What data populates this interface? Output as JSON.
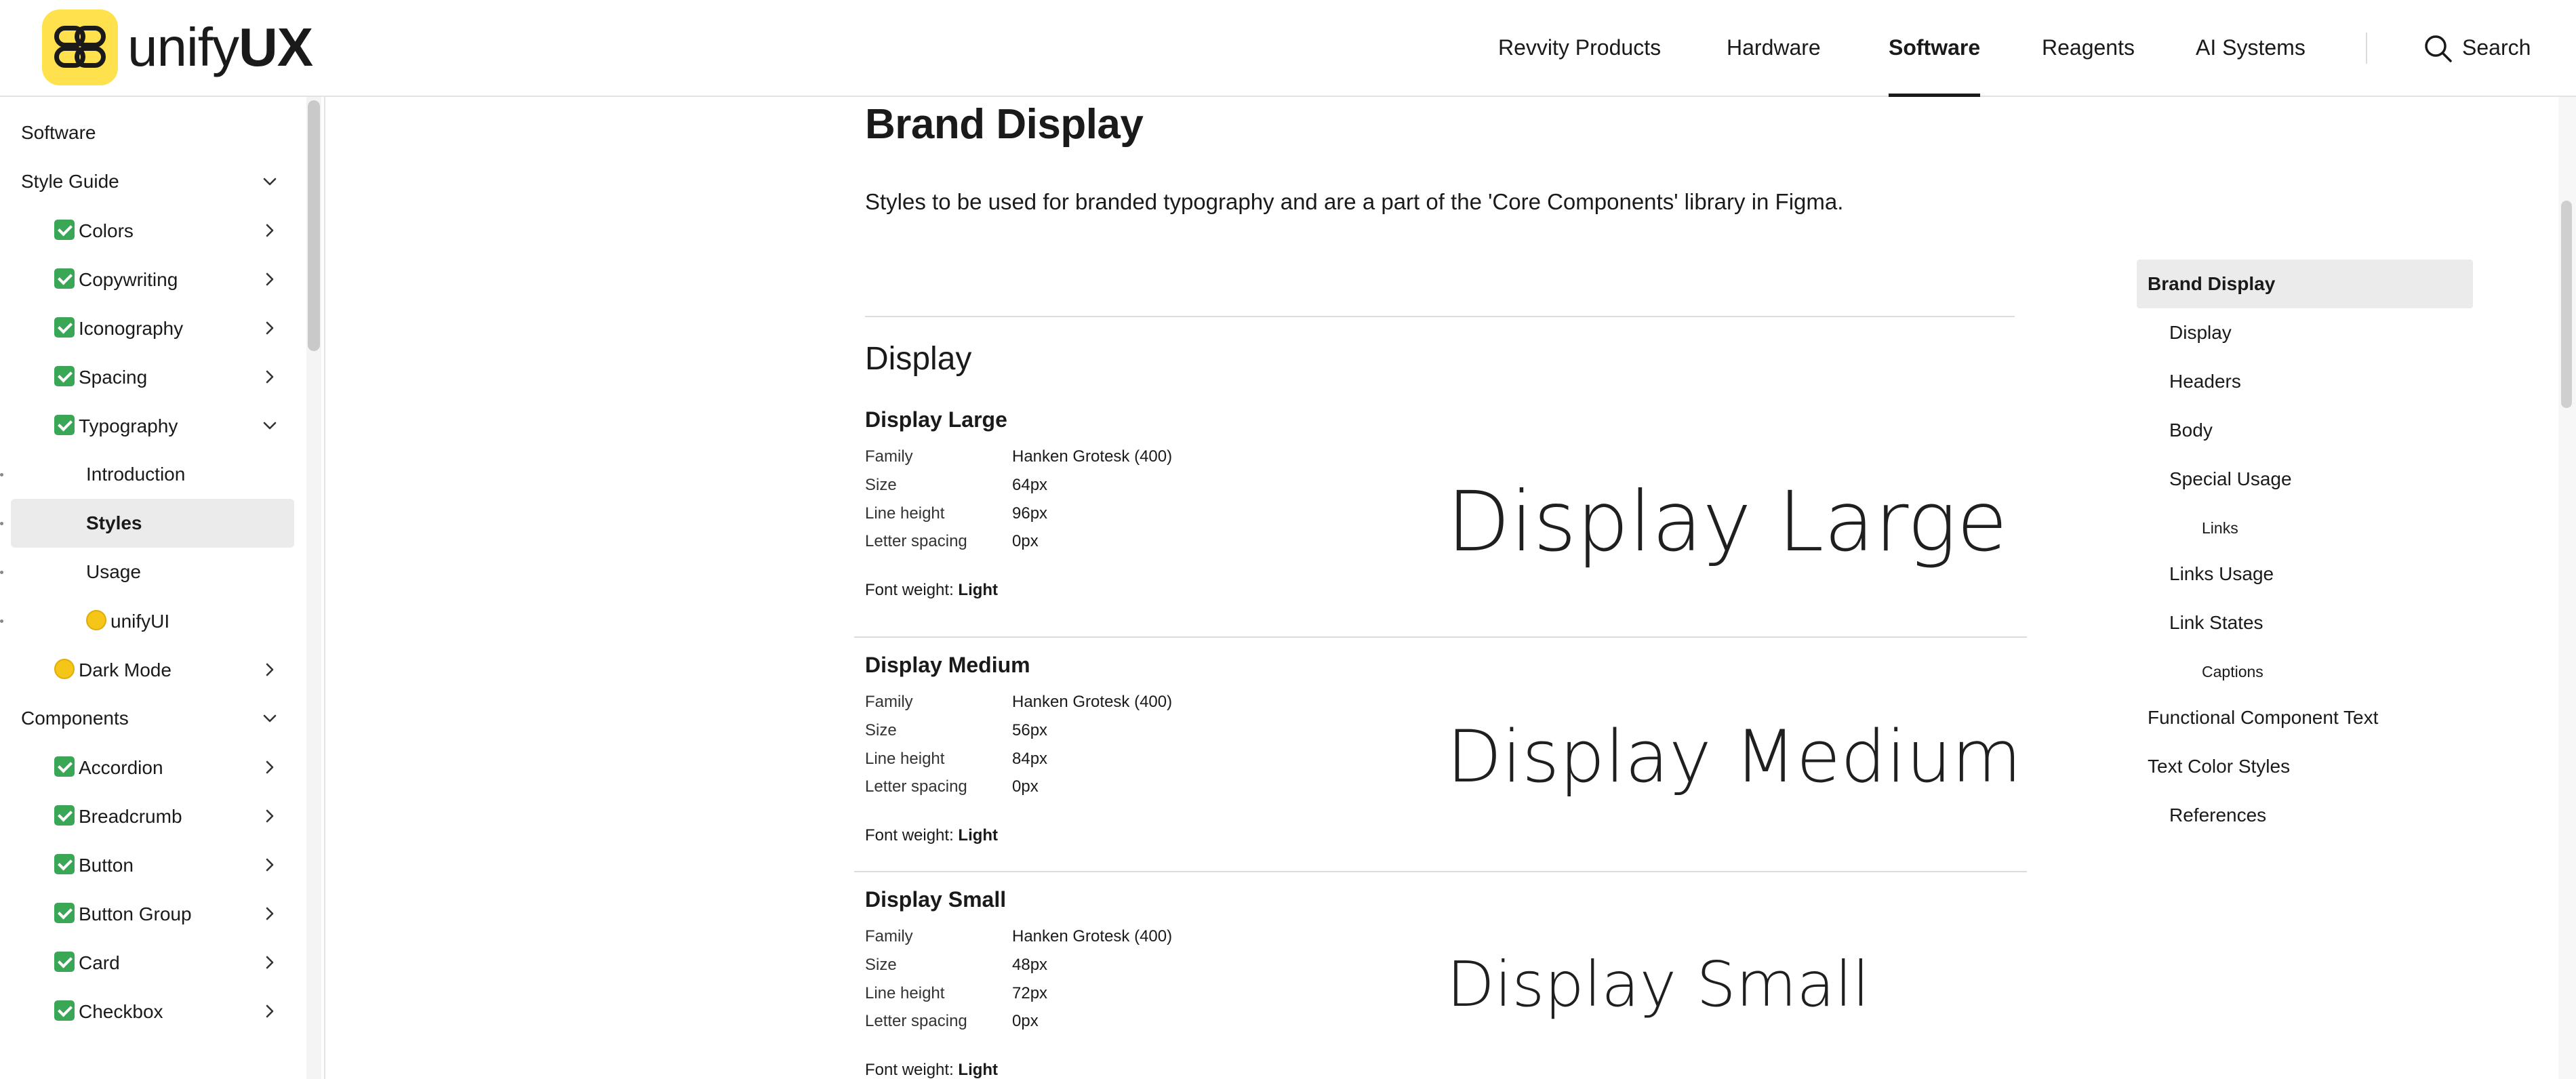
{
  "header": {
    "logo_text_light": "unify",
    "logo_text_bold": "UX",
    "nav": [
      "Revvity Products",
      "Hardware",
      "Software",
      "Reagents",
      "AI Systems"
    ],
    "active_nav": "Software",
    "search_label": "Search"
  },
  "sidebar": {
    "items": [
      {
        "label": "Software",
        "level": 0,
        "marker": "none",
        "chevron": "none"
      },
      {
        "label": "Style Guide",
        "level": 0,
        "marker": "none",
        "chevron": "down"
      },
      {
        "label": "Colors",
        "level": 1,
        "marker": "check",
        "chevron": "right"
      },
      {
        "label": "Copywriting",
        "level": 1,
        "marker": "check",
        "chevron": "right"
      },
      {
        "label": "Iconography",
        "level": 1,
        "marker": "check",
        "chevron": "right"
      },
      {
        "label": "Spacing",
        "level": 1,
        "marker": "check",
        "chevron": "right"
      },
      {
        "label": "Typography",
        "level": 1,
        "marker": "check",
        "chevron": "down"
      },
      {
        "label": "Introduction",
        "level": 2,
        "marker": "none",
        "chevron": "none"
      },
      {
        "label": "Styles",
        "level": 2,
        "marker": "none",
        "chevron": "none",
        "selected": true
      },
      {
        "label": "Usage",
        "level": 2,
        "marker": "none",
        "chevron": "none"
      },
      {
        "label": "unifyUI",
        "level": 2,
        "marker": "dot",
        "chevron": "none"
      },
      {
        "label": "Dark Mode",
        "level": 1,
        "marker": "dot",
        "chevron": "right"
      },
      {
        "label": "Components",
        "level": 0,
        "marker": "none",
        "chevron": "down"
      },
      {
        "label": "Accordion",
        "level": 1,
        "marker": "check",
        "chevron": "right"
      },
      {
        "label": "Breadcrumb",
        "level": 1,
        "marker": "check",
        "chevron": "right"
      },
      {
        "label": "Button",
        "level": 1,
        "marker": "check",
        "chevron": "right"
      },
      {
        "label": "Button Group",
        "level": 1,
        "marker": "check",
        "chevron": "right"
      },
      {
        "label": "Card",
        "level": 1,
        "marker": "check",
        "chevron": "right"
      },
      {
        "label": "Checkbox",
        "level": 1,
        "marker": "check",
        "chevron": "right"
      }
    ]
  },
  "main": {
    "title": "Brand Display",
    "intro": "Styles to be used for branded typography and are a part of the 'Core Components' library in Figma.",
    "section_title": "Display",
    "prop_labels": {
      "family": "Family",
      "size": "Size",
      "line_height": "Line height",
      "letter_spacing": "Letter spacing",
      "font_weight": "Font weight:"
    },
    "styles": [
      {
        "name": "Display Large",
        "family": "Hanken Grotesk (400)",
        "size": "64px",
        "line_height": "96px",
        "letter_spacing": "0px",
        "font_weight": "Light",
        "sample": "Display Large"
      },
      {
        "name": "Display Medium",
        "family": "Hanken Grotesk (400)",
        "size": "56px",
        "line_height": "84px",
        "letter_spacing": "0px",
        "font_weight": "Light",
        "sample": "Display Medium"
      },
      {
        "name": "Display Small",
        "family": "Hanken Grotesk (400)",
        "size": "48px",
        "line_height": "72px",
        "letter_spacing": "0px",
        "font_weight": "Light",
        "sample": "Display Small"
      }
    ]
  },
  "toc": {
    "items": [
      {
        "label": "Brand Display",
        "indent": 0,
        "active": true
      },
      {
        "label": "Display",
        "indent": 1
      },
      {
        "label": "Headers",
        "indent": 1
      },
      {
        "label": "Body",
        "indent": 1
      },
      {
        "label": "Special Usage",
        "indent": 1
      },
      {
        "label": "Links",
        "indent": 2
      },
      {
        "label": "Links Usage",
        "indent": 1
      },
      {
        "label": "Link States",
        "indent": 1
      },
      {
        "label": "Captions",
        "indent": 2
      },
      {
        "label": "Functional Component Text",
        "indent": 0
      },
      {
        "label": "Text Color Styles",
        "indent": 0
      },
      {
        "label": "References",
        "indent": 1
      }
    ]
  },
  "colors": {
    "accent": "#ffe14d",
    "check": "#3aa757",
    "dot": "#f5c518",
    "selected_bg": "#ebebeb"
  }
}
